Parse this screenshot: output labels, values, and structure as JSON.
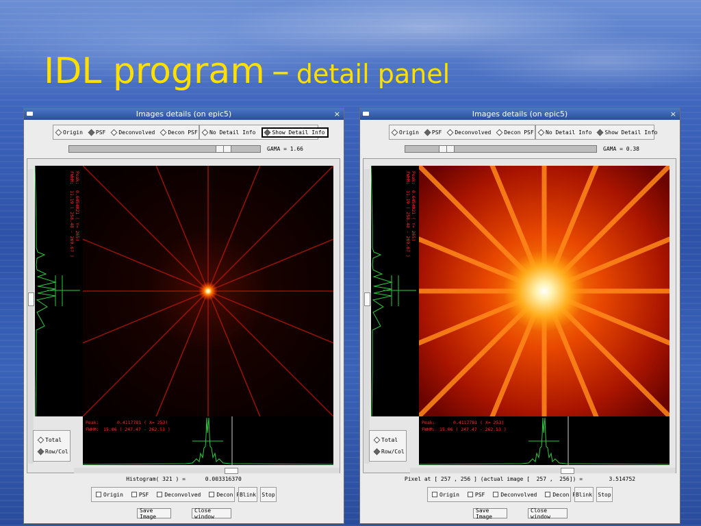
{
  "slide": {
    "title_main": "IDL program",
    "title_dash": "–",
    "title_sub": "detail panel"
  },
  "colors": {
    "title": "#ffdf00",
    "titlebar": "#2f5aa8",
    "profile_line": "#2ecc40",
    "overlay_text": "#ff2a2a"
  },
  "windows": [
    {
      "title": "Images details (on epic5)",
      "close_icon": "×",
      "image_options": [
        "Origin",
        "PSF",
        "Deconvolved",
        "Decon PSF"
      ],
      "selected_image": "PSF",
      "detail_options": [
        "No Detail Info",
        "Show Detail Info"
      ],
      "selected_detail": "Show Detail Info",
      "gamma_label": "GAMA = 1.66",
      "gamma": 1.66,
      "peak_label": "Peak:",
      "peak_value": "0.4117781 ( X= 253)",
      "fwhm_label": "FWHM:",
      "fwhm_value": "15.06 ( 247.47 - 262.53 )",
      "vpeak_label": "Peak:",
      "vpeak_value": "0.6454021 ( Y= 265)",
      "vfwhm_label": "FWHM:",
      "vfwhm_value": "11.19 ( 258.48 - 269.67 )",
      "profile_options": [
        "Total",
        "Row/Col"
      ],
      "selected_profile": "Row/Col",
      "status": "Histogram( 321 ) =      0.003316370",
      "display_options": [
        "Origin",
        "PSF",
        "Deconvolved",
        "Decon PSF"
      ],
      "blink_label": "Blink",
      "stop_label": "Stop",
      "save_label": "Save Image",
      "close_label": "Close window"
    },
    {
      "title": "Images details (on epic5)",
      "close_icon": "×",
      "image_options": [
        "Origin",
        "PSF",
        "Deconvolved",
        "Decon PSF"
      ],
      "selected_image": "PSF",
      "detail_options": [
        "No Detail Info",
        "Show Detail Info"
      ],
      "selected_detail": "Show Detail Info",
      "gamma_label": "GAMA = 0.38",
      "gamma": 0.38,
      "peak_label": "Peak:",
      "peak_value": "0.4117781 ( X= 253)",
      "fwhm_label": "FWHM:",
      "fwhm_value": "15.06 ( 247.47 - 262.53 )",
      "vpeak_label": "Peak:",
      "vpeak_value": "0.6454021 ( Y= 265)",
      "vfwhm_label": "FWHM:",
      "vfwhm_value": "11.19 ( 258.48 - 269.67 )",
      "profile_options": [
        "Total",
        "Row/Col"
      ],
      "selected_profile": "Row/Col",
      "status": "Pixel at [ 257 , 256 ] (actual image [  257 ,  256]) =        3.514752",
      "display_options": [
        "Origin",
        "PSF",
        "Deconvolved",
        "Decon PSF"
      ],
      "blink_label": "Blink",
      "stop_label": "Stop",
      "save_label": "Save Image",
      "close_label": "Close window"
    }
  ]
}
